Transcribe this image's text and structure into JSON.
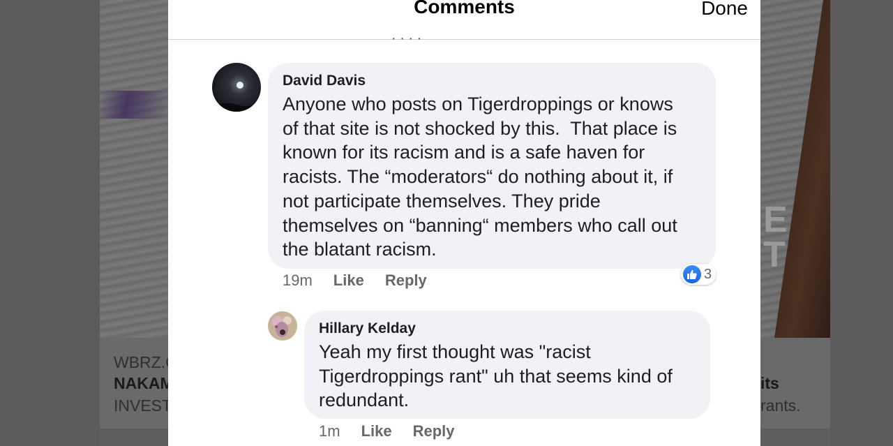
{
  "background": {
    "card_left": {
      "source": "WBRZ.C",
      "headline": "NAKAM",
      "sub": "INVEST"
    },
    "card_right": {
      "headline": "its",
      "sub": "rants."
    },
    "photo_letters": "E\nT"
  },
  "modal": {
    "title": "Comments",
    "done_label": "Done",
    "cut_text": "· · · ·"
  },
  "comments": [
    {
      "author": "David Davis",
      "text": "Anyone who posts on Tigerdroppings or knows\nof that site is not shocked by this.  That place is\nknown for its racism and is a safe haven for\nracists. The “moderators“ do nothing about it, if\nnot participate themselves. They pride\nthemselves on “banning“ members who call out\nthe blatant racism.",
      "time": "19m",
      "like_label": "Like",
      "reply_label": "Reply",
      "reaction_count": "3"
    },
    {
      "author": "Hillary Kelday",
      "text": "Yeah my first thought was \"racist\nTigerdroppings rant\" uh that seems kind of\nredundant.",
      "time": "1m",
      "like_label": "Like",
      "reply_label": "Reply"
    }
  ],
  "colors": {
    "bubble": "#f0f2f5",
    "like_blue": "#1877f2",
    "meta_gray": "#65676b"
  }
}
